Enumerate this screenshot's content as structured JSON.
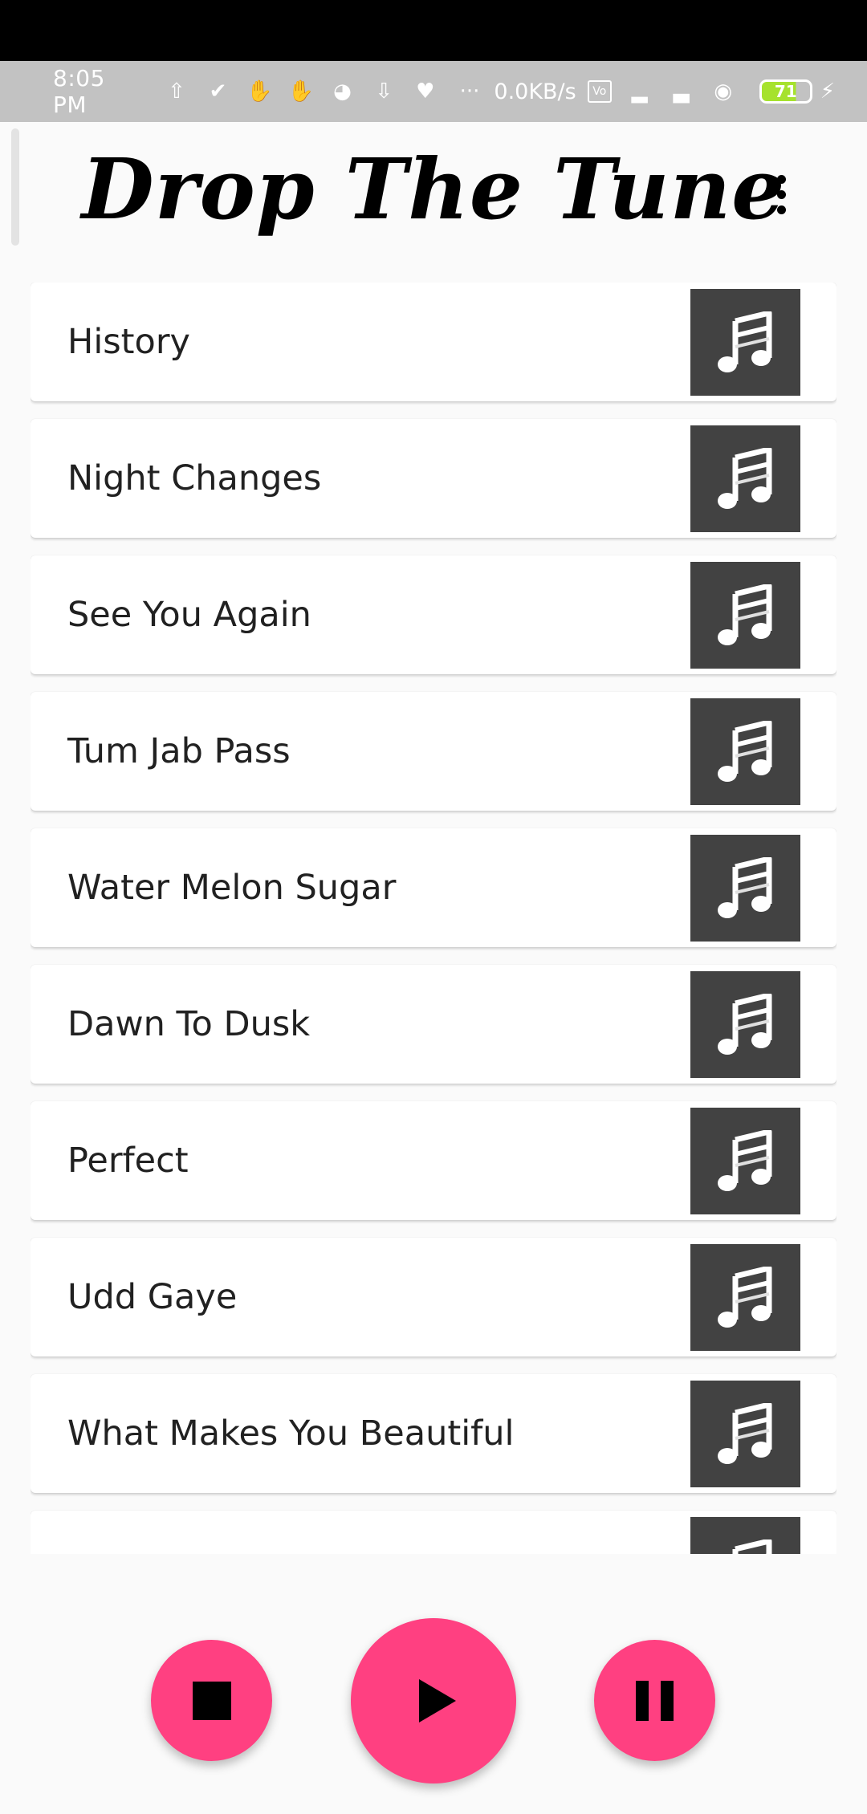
{
  "status_bar": {
    "time": "8:05 PM",
    "network_speed": "0.0KB/s",
    "battery_level": "71",
    "dots": "···",
    "icons": [
      "upload-icon",
      "check-circle-icon",
      "hand-icon",
      "hand-icon",
      "bowl-icon",
      "download-icon",
      "heart-icon",
      "volte-icon",
      "signal-icon",
      "signal-icon",
      "wifi-icon",
      "battery-icon",
      "charging-icon"
    ]
  },
  "header": {
    "title": "Drop The Tune",
    "menu_icon": "more-vert-icon"
  },
  "songs": [
    {
      "title": "History",
      "icon": "music-note-icon"
    },
    {
      "title": "Night Changes",
      "icon": "music-note-icon"
    },
    {
      "title": "See You Again",
      "icon": "music-note-icon"
    },
    {
      "title": "Tum Jab Pass",
      "icon": "music-note-icon"
    },
    {
      "title": "Water Melon Sugar",
      "icon": "music-note-icon"
    },
    {
      "title": "Dawn To Dusk",
      "icon": "music-note-icon"
    },
    {
      "title": "Perfect",
      "icon": "music-note-icon"
    },
    {
      "title": "Udd Gaye",
      "icon": "music-note-icon"
    },
    {
      "title": "What Makes You Beautiful",
      "icon": "music-note-icon"
    },
    {
      "title": "",
      "icon": "music-note-icon"
    }
  ],
  "controls": {
    "stop_icon": "stop-icon",
    "play_icon": "play-icon",
    "pause_icon": "pause-icon"
  },
  "colors": {
    "accent": "#ff4081",
    "art_background": "#424242",
    "status_bar": "#c2c2c2",
    "background": "#fafafa"
  }
}
